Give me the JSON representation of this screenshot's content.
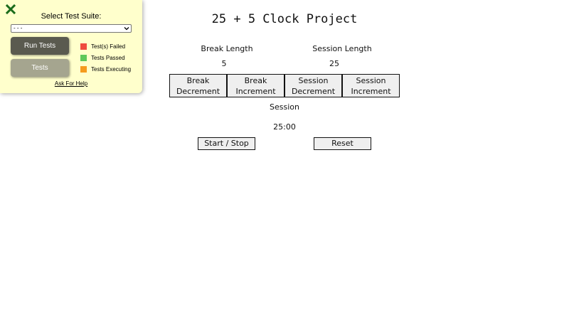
{
  "test_panel": {
    "close_icon": "close-x-icon",
    "suite_label": "Select Test Suite:",
    "suite_selected": "- - -",
    "run_button": "Run Tests",
    "tests_button": "Tests",
    "legend": [
      {
        "label": "Test(s) Failed",
        "color": "#ef4b3f"
      },
      {
        "label": "Tests Passed",
        "color": "#5ec85a"
      },
      {
        "label": "Tests Executing",
        "color": "#f59b1e"
      }
    ],
    "help_link": "Ask For Help",
    "colors": {
      "panel_bg": "#ffffcc",
      "close_icon": "#1a6b1a",
      "run_button_bg": "#5a5a4f",
      "tests_button_bg": "#a5a58f"
    }
  },
  "app": {
    "title": "25 + 5 Clock Project",
    "break_label": "Break Length",
    "session_label": "Session Length",
    "break_length": "5",
    "session_length": "25",
    "controls": {
      "break_decrement": [
        "Break",
        "Decrement"
      ],
      "break_increment": [
        "Break",
        "Increment"
      ],
      "session_decrement": [
        "Session",
        "Decrement"
      ],
      "session_increment": [
        "Session",
        "Increment"
      ]
    },
    "timer_label": "Session",
    "time_left": "25:00",
    "start_stop": "Start / Stop",
    "reset": "Reset"
  }
}
